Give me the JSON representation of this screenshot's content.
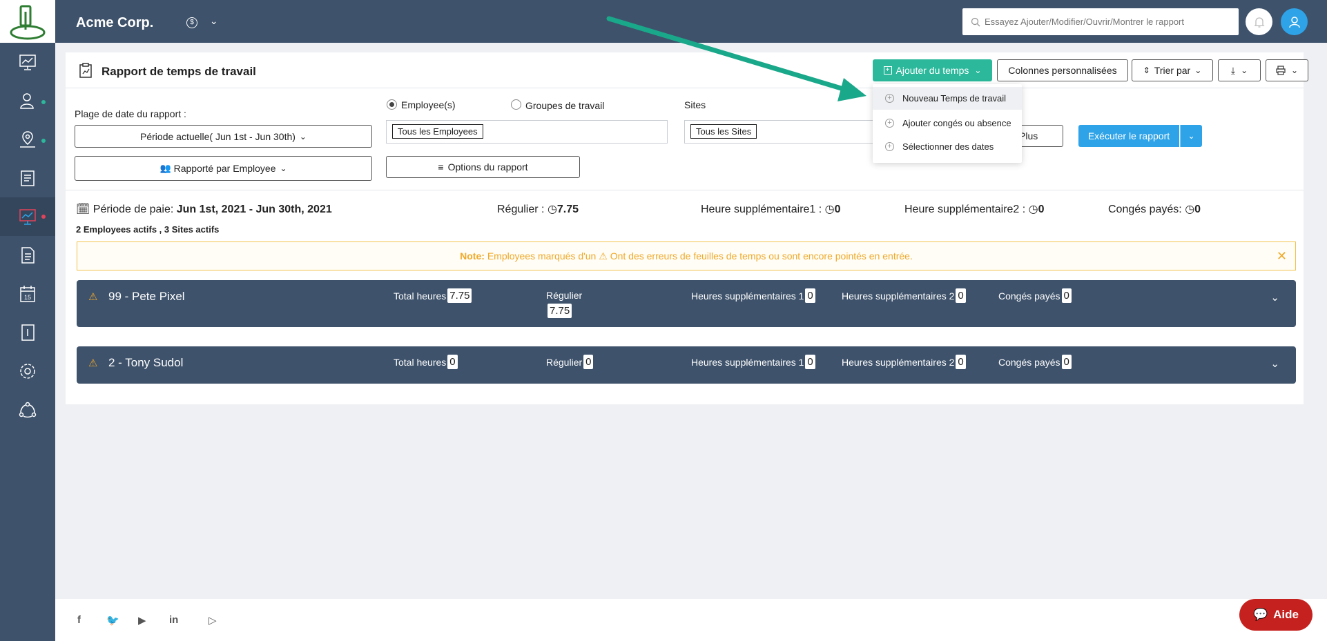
{
  "header": {
    "company": "Acme Corp.",
    "currency": "$",
    "search_placeholder": "Essayez Ajouter/Modifier/Ouvrir/Montrer le rapport"
  },
  "sidebar": {
    "items": [
      {
        "icon": "dashboard-icon"
      },
      {
        "icon": "employee-icon",
        "dot": "#2bb89b"
      },
      {
        "icon": "location-icon",
        "dot": "#2bb89b"
      },
      {
        "icon": "timesheet-icon"
      },
      {
        "icon": "reports-icon",
        "dot": "#e0435a",
        "active": true
      },
      {
        "icon": "document-icon"
      },
      {
        "icon": "calendar-icon",
        "calendar_day": "15"
      },
      {
        "icon": "notebook-icon"
      },
      {
        "icon": "settings-icon"
      },
      {
        "icon": "integrations-icon"
      }
    ]
  },
  "report": {
    "title": "Rapport de temps de travail",
    "buttons": {
      "add_time": "Ajouter du temps",
      "custom_columns": "Colonnes personnalisées",
      "sort_by": "Trier par"
    },
    "dropdown": {
      "items": [
        "Nouveau Temps de travail",
        "Ajouter congés ou absence",
        "Sélectionner des dates"
      ]
    },
    "filters": {
      "date_range_label": "Plage de date du rapport :",
      "period_button": "Période actuelle( Jun 1st - Jun 30th)",
      "group_by_button": "Rapporté par Employee",
      "radio_employees": "Employee(s)",
      "radio_groups": "Groupes de travail",
      "employees_chip": "Tous les Employees",
      "sites_label": "Sites",
      "sites_chip": "Tous les Sites",
      "options_button": "Options du rapport",
      "plus_button": "Plus",
      "run_button": "Exécuter le rapport"
    },
    "summary": {
      "pay_period_label": "Période de paie:",
      "pay_period_value": "Jun 1st, 2021 - Jun 30th, 2021",
      "regular_label": "Régulier :",
      "regular_value": "7.75",
      "ot1_label": "Heure supplémentaire1 :",
      "ot1_value": "0",
      "ot2_label": "Heure supplémentaire2 :",
      "ot2_value": "0",
      "paid_leave_label": "Congés payés:",
      "paid_leave_value": "0",
      "counts": "2 Employees actifs , 3 Sites actifs"
    },
    "note": {
      "prefix": "Note:",
      "text_before_icon": "Employees marqués d'un",
      "text_after_icon": "Ont des erreurs de feuilles de temps ou sont encore pointés en entrée."
    },
    "stat_labels": {
      "total": "Total heures",
      "regular": "Régulier",
      "ot1": "Heures supplémentaires 1",
      "ot2": "Heures supplémentaires 2",
      "paid_leave": "Congés payés"
    },
    "employees": [
      {
        "name": "99 - Pete Pixel",
        "total": "7.75",
        "regular": "7.75",
        "ot1": "0",
        "ot2": "0",
        "paid_leave": "0"
      },
      {
        "name": "2 - Tony Sudol",
        "total": "0",
        "regular": "0",
        "ot1": "0",
        "ot2": "0",
        "paid_leave": "0"
      }
    ]
  },
  "help_button": "Aide",
  "colors": {
    "primary": "#3e526b",
    "accent_green": "#2bb89b",
    "accent_blue": "#2ea3e8",
    "warning": "#f0a92a",
    "help_red": "#c5221f"
  }
}
